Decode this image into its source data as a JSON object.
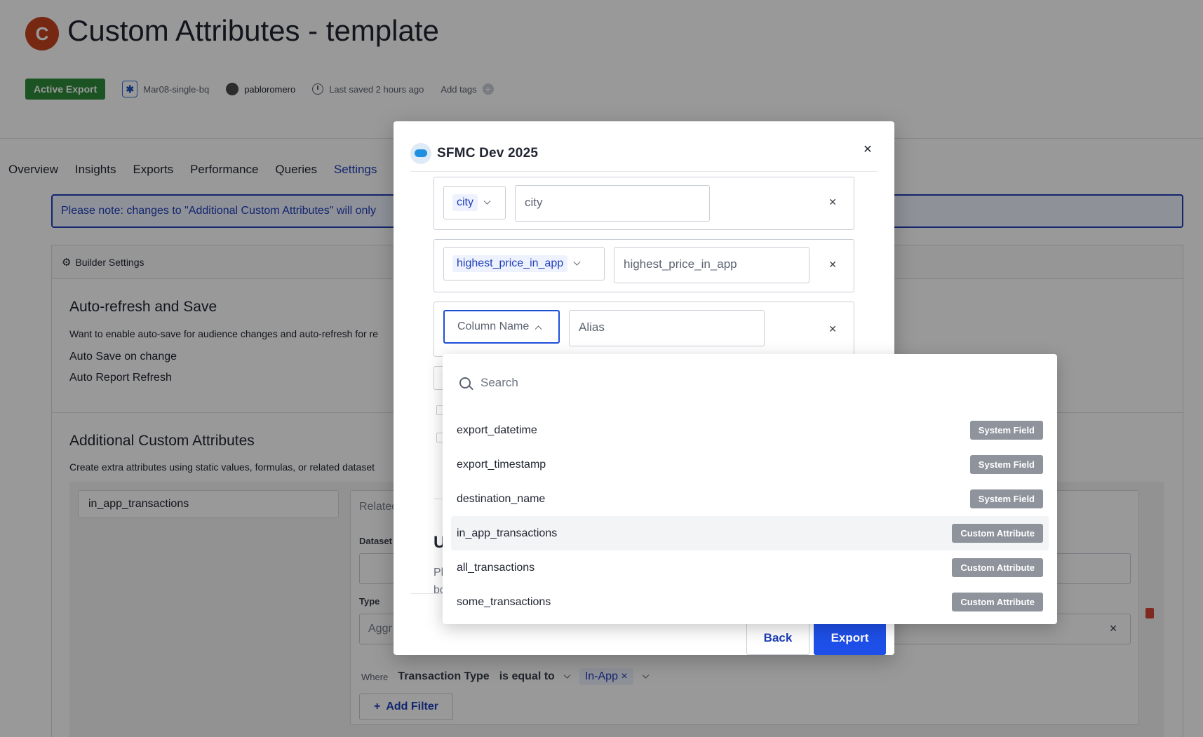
{
  "page": {
    "avatar_letter": "C",
    "title": "Custom Attributes - template",
    "status_badge": "Active Export",
    "destination": "Mar08-single-bq",
    "user": "pabloromero",
    "saved": "Last saved 2 hours ago",
    "add_tags": "Add tags",
    "tabs": [
      "Overview",
      "Insights",
      "Exports",
      "Performance",
      "Queries",
      "Settings"
    ],
    "active_tab": "Settings",
    "note": "Please note: changes to \"Additional Custom Attributes\" will only",
    "builder_settings": "Builder Settings",
    "auto_refresh": {
      "title": "Auto-refresh and Save",
      "desc": "Want to enable auto-save for audience changes and auto-refresh for re",
      "save_label": "Auto Save on change",
      "refresh_label": "Auto Report Refresh"
    },
    "additional": {
      "title": "Additional Custom Attributes",
      "desc": "Create extra attributes using static values, formulas, or related dataset",
      "attr_name": "in_app_transactions",
      "related_label": "Related",
      "dataset_label": "Dataset",
      "type_label": "Type",
      "type_placeholder": "Aggr",
      "where_label": "Where",
      "filter_field": "Transaction Type",
      "filter_op": "is equal to",
      "filter_value": "In-App",
      "add_filter": "Add Filter"
    }
  },
  "modal": {
    "title": "SFMC Dev 2025",
    "rows": [
      {
        "column": "city",
        "alias": "city"
      },
      {
        "column": "highest_price_in_app",
        "alias": "highest_price_in_app"
      }
    ],
    "new_row": {
      "column_placeholder": "Column Name",
      "alias_placeholder": "Alias"
    },
    "partial_heading": "U",
    "partial_text_1": "Pl",
    "partial_text_2": "bc",
    "back": "Back",
    "export": "Export"
  },
  "dropdown": {
    "search_placeholder": "Search",
    "items": [
      {
        "name": "export_datetime",
        "badge": "System Field"
      },
      {
        "name": "export_timestamp",
        "badge": "System Field"
      },
      {
        "name": "destination_name",
        "badge": "System Field"
      },
      {
        "name": "in_app_transactions",
        "badge": "Custom Attribute"
      },
      {
        "name": "all_transactions",
        "badge": "Custom Attribute"
      },
      {
        "name": "some_transactions",
        "badge": "Custom Attribute"
      }
    ]
  },
  "colors": {
    "accent": "#1e4fe8",
    "active_badge": "#2f8a3a",
    "avatar": "#c5441f"
  }
}
